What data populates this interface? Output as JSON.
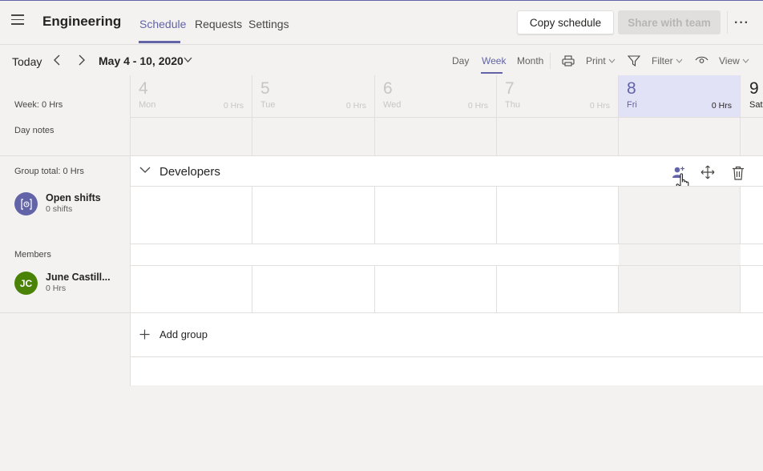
{
  "header": {
    "title": "Engineering",
    "tabs": [
      {
        "label": "Schedule",
        "active": true
      },
      {
        "label": "Requests",
        "active": false
      },
      {
        "label": "Settings",
        "active": false
      }
    ],
    "copy_button": "Copy schedule",
    "share_button": "Share with team",
    "more": "···"
  },
  "toolbar": {
    "today": "Today",
    "date_range": "May 4 - 10, 2020",
    "views": [
      "Day",
      "Week",
      "Month"
    ],
    "active_view": "Week",
    "print": "Print",
    "filter": "Filter",
    "view": "View"
  },
  "left": {
    "week_total": "Week: 0 Hrs",
    "day_notes": "Day notes",
    "group_total": "Group total: 0 Hrs",
    "open_shifts": {
      "name": "Open shifts",
      "sub": "0 shifts"
    },
    "members_label": "Members",
    "member": {
      "initials": "JC",
      "name": "June Castill...",
      "sub": "0 Hrs",
      "color": "#498205"
    }
  },
  "days": [
    {
      "num": "4",
      "name": "Mon",
      "hrs": "0 Hrs"
    },
    {
      "num": "5",
      "name": "Tue",
      "hrs": "0 Hrs"
    },
    {
      "num": "6",
      "name": "Wed",
      "hrs": "0 Hrs"
    },
    {
      "num": "7",
      "name": "Thu",
      "hrs": "0 Hrs"
    },
    {
      "num": "8",
      "name": "Fri",
      "hrs": "0 Hrs"
    },
    {
      "num": "9",
      "name": "Sat",
      "hrs": ""
    }
  ],
  "group": {
    "name": "Developers"
  },
  "add_group": "Add group",
  "colors": {
    "accent": "#6264a7",
    "open_shift_avatar": "#6264a7"
  }
}
